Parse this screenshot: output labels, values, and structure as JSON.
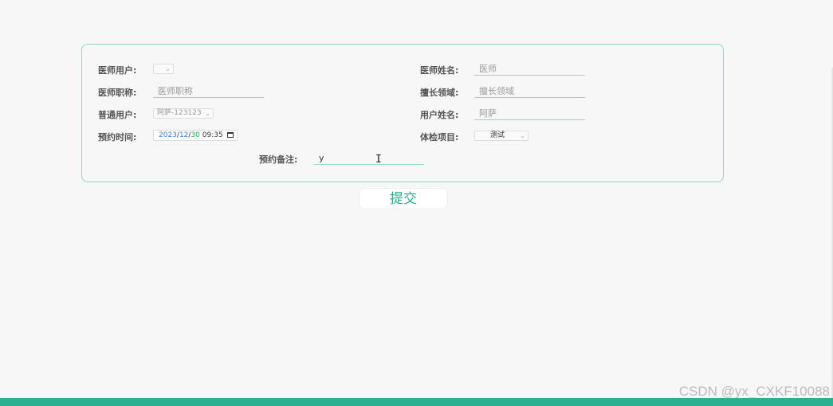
{
  "form": {
    "doctor_user_label": "医师用户:",
    "doctor_name_label": "医师姓名:",
    "doctor_name_placeholder": "医师",
    "doctor_title_label": "医师职称:",
    "doctor_title_placeholder": "医师职称",
    "specialty_label": "擅长领域:",
    "specialty_placeholder": "擅长领域",
    "normal_user_label": "普通用户:",
    "normal_user_value": "阿萨-123123",
    "username_label": "用户姓名:",
    "username_placeholder": "阿萨",
    "appointment_time_label": "预约时间:",
    "date_year": "2023",
    "date_month": "12",
    "date_day": "30",
    "date_time": "09:35",
    "exam_item_label": "体检项目:",
    "exam_item_value": "测试",
    "note_label": "预约备注:",
    "note_value": "y"
  },
  "submit_label": "提交",
  "watermark": "CSDN @yx_CXKF10088",
  "colors": {
    "accent": "#2bb091",
    "border": "#8fd6c6"
  }
}
